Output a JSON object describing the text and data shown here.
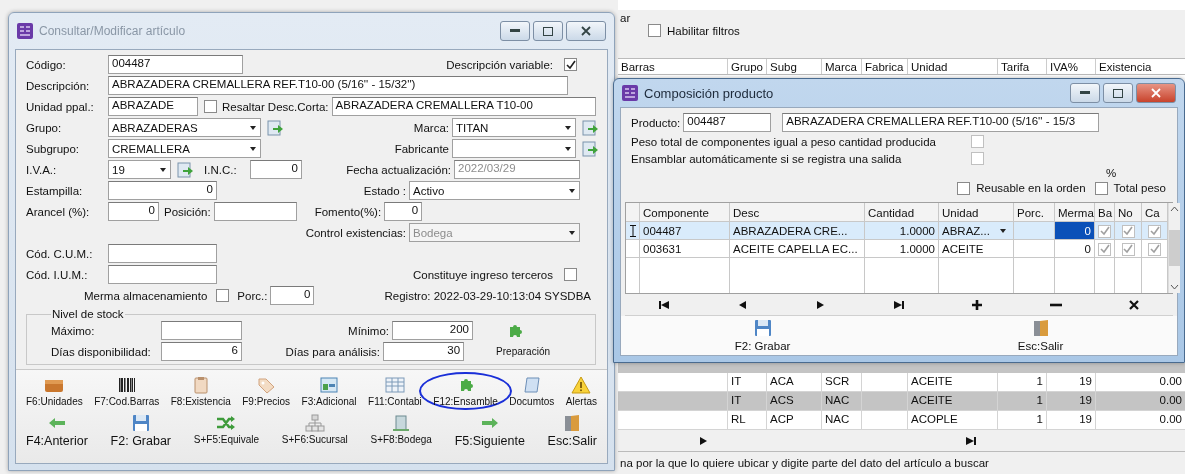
{
  "background_window": {
    "label_partial": "ar",
    "filter_checkbox": {
      "label": "Habilitar filtros",
      "checked": false
    },
    "grid": {
      "columns": [
        "Barras",
        "Grupo",
        "Subg",
        "Marca",
        "Fabrica",
        "Unidad",
        "Tarifa",
        "IVA%",
        "Existencia"
      ],
      "rows": [
        {
          "grupo": "IT",
          "subg": "ACA",
          "marca": "SCR",
          "unidad": "ACEITE",
          "tarifa": "1",
          "iva": "19",
          "existencia": "0.00"
        },
        {
          "grupo": "IT",
          "subg": "ACS",
          "marca": "NAC",
          "unidad": "ACEITE",
          "tarifa": "1",
          "iva": "19",
          "existencia": "0.00"
        },
        {
          "grupo": "RL",
          "subg": "ACP",
          "marca": "NAC",
          "unidad": "ACOPLE",
          "tarifa": "1",
          "iva": "19",
          "existencia": "0.00"
        }
      ]
    },
    "status": "na por la que lo quiere ubicar y digite parte del dato del artículo a buscar"
  },
  "article_window": {
    "title": "Consultar/Modificar artículo",
    "codigo": {
      "label": "Código:",
      "value": "004487"
    },
    "descripcion_variable": {
      "label": "Descripción variable:",
      "checked": true
    },
    "descripcion": {
      "label": "Descripción:",
      "value": "ABRAZADERA CREMALLERA REF.T10-00  (5/16'' - 15/32'')"
    },
    "unidad": {
      "label": "Unidad ppal.:",
      "value": "ABRAZADE"
    },
    "resaltar": {
      "label": "Resaltar",
      "checked": false
    },
    "desc_corta": {
      "label": "Desc.Corta:",
      "value": "ABRAZADERA CREMALLERA T10-00"
    },
    "grupo": {
      "label": "Grupo:",
      "value": "ABRAZADERAS"
    },
    "marca": {
      "label": "Marca:",
      "value": "TITAN"
    },
    "subgrupo": {
      "label": "Subgrupo:",
      "value": "CREMALLERA"
    },
    "fabricante": {
      "label": "Fabricante"
    },
    "iva": {
      "label": "I.V.A.:",
      "value": "19"
    },
    "inc": {
      "label": "I.N.C.:",
      "value": "0"
    },
    "fecha": {
      "label": "Fecha actualización:",
      "value": "2022/03/29",
      "disabled": true
    },
    "estampilla": {
      "label": "Estampilla:",
      "value": "0"
    },
    "estado": {
      "label": "Estado :",
      "value": "Activo"
    },
    "arancel": {
      "label": "Arancel (%):",
      "value": "0"
    },
    "posicion": {
      "label": "Posición:"
    },
    "fomento": {
      "label": "Fomento(%):",
      "value": "0"
    },
    "control": {
      "label": "Control existencias:",
      "value": "Bodega",
      "disabled": true
    },
    "cum": {
      "label": "Cód. C.U.M.:"
    },
    "ium": {
      "label": "Cód. I.U.M.:"
    },
    "ingreso_terceros": {
      "label": "Constituye ingreso terceros",
      "checked": false
    },
    "merma": {
      "label": "Merma almacenamiento",
      "checked": false
    },
    "porc": {
      "label": "Porc.:",
      "value": "0"
    },
    "registro": "Registro: 2022-03-29-10:13:04 SYSDBA",
    "stock": {
      "title": "Nivel de stock",
      "maximo": {
        "label": "Máximo:"
      },
      "minimo": {
        "label": "Mínimo:",
        "value": "200"
      },
      "dias_disp": {
        "label": "Días disponibilidad:",
        "value": "6"
      },
      "dias_analisis": {
        "label": "Días para análisis:",
        "value": "30"
      },
      "preparacion": "Preparación"
    },
    "toolbar_top": [
      {
        "label": "F6:Unidades",
        "kind": "box",
        "highlighted": false
      },
      {
        "label": "F7:Cod.Barras",
        "kind": "barcode",
        "highlighted": false
      },
      {
        "label": "F8:Existencia",
        "kind": "clipboard",
        "highlighted": false
      },
      {
        "label": "F9:Precios",
        "kind": "tag",
        "highlighted": false
      },
      {
        "label": "F3:Adicional",
        "kind": "panel",
        "highlighted": false
      },
      {
        "label": "F11:Contabi",
        "kind": "table",
        "highlighted": false
      },
      {
        "label": "F12:Ensamble",
        "kind": "puzzle",
        "highlighted": true
      },
      {
        "label": "Documtos",
        "kind": "scroll",
        "highlighted": false
      },
      {
        "label": "Alertas",
        "kind": "warning",
        "highlighted": false
      }
    ],
    "toolbar_bottom": [
      {
        "label": "F4:Anterior",
        "kind": "arrow-left",
        "large": true
      },
      {
        "label": "F2: Grabar",
        "kind": "floppy",
        "large": true
      },
      {
        "label": "S+F5:Equivale",
        "kind": "shuffle",
        "large": false
      },
      {
        "label": "S+F6:Sucursal",
        "kind": "network",
        "large": false
      },
      {
        "label": "S+F8:Bodega",
        "kind": "building",
        "large": false
      },
      {
        "label": "F5:Siguiente",
        "kind": "arrow-right",
        "large": true
      },
      {
        "label": "Esc:Salir",
        "kind": "door",
        "large": true
      }
    ]
  },
  "composition_window": {
    "title": "Composición producto",
    "producto": {
      "label": "Producto:",
      "code": "004487",
      "description": "ABRAZADERA CREMALLERA REF.T10-00  (5/16'' - 15/3"
    },
    "options": [
      {
        "label": "Peso total de componentes igual a peso cantidad producida",
        "checked": false
      },
      {
        "label": "Ensamblar automáticamente si se registra una salida",
        "checked": false
      }
    ],
    "percent_label": "%",
    "reusable": {
      "label": "Reusable en la orden",
      "checked": false
    },
    "total_peso": {
      "label": "Total peso",
      "checked": false
    },
    "grid": {
      "columns": [
        "Componente",
        "Desc",
        "Cantidad",
        "Unidad",
        "Porc.",
        "Merma",
        "Ba",
        "No",
        "Ca"
      ],
      "rows": [
        {
          "componente": "004487",
          "desc": "ABRAZADERA CRE...",
          "cantidad": "1.0000",
          "unidad": "ABRAZ...",
          "merma": "0",
          "ba": true,
          "no": true,
          "ca": true,
          "selected": true
        },
        {
          "componente": "003631",
          "desc": "ACEITE CAPELLA EC...",
          "cantidad": "1.0000",
          "unidad": "ACEITE",
          "merma": "0",
          "ba": true,
          "no": true,
          "ca": true,
          "selected": false
        }
      ]
    },
    "buttons": [
      {
        "label": "F2: Grabar",
        "kind": "floppy"
      },
      {
        "label": "Esc:Salir",
        "kind": "door"
      }
    ]
  }
}
